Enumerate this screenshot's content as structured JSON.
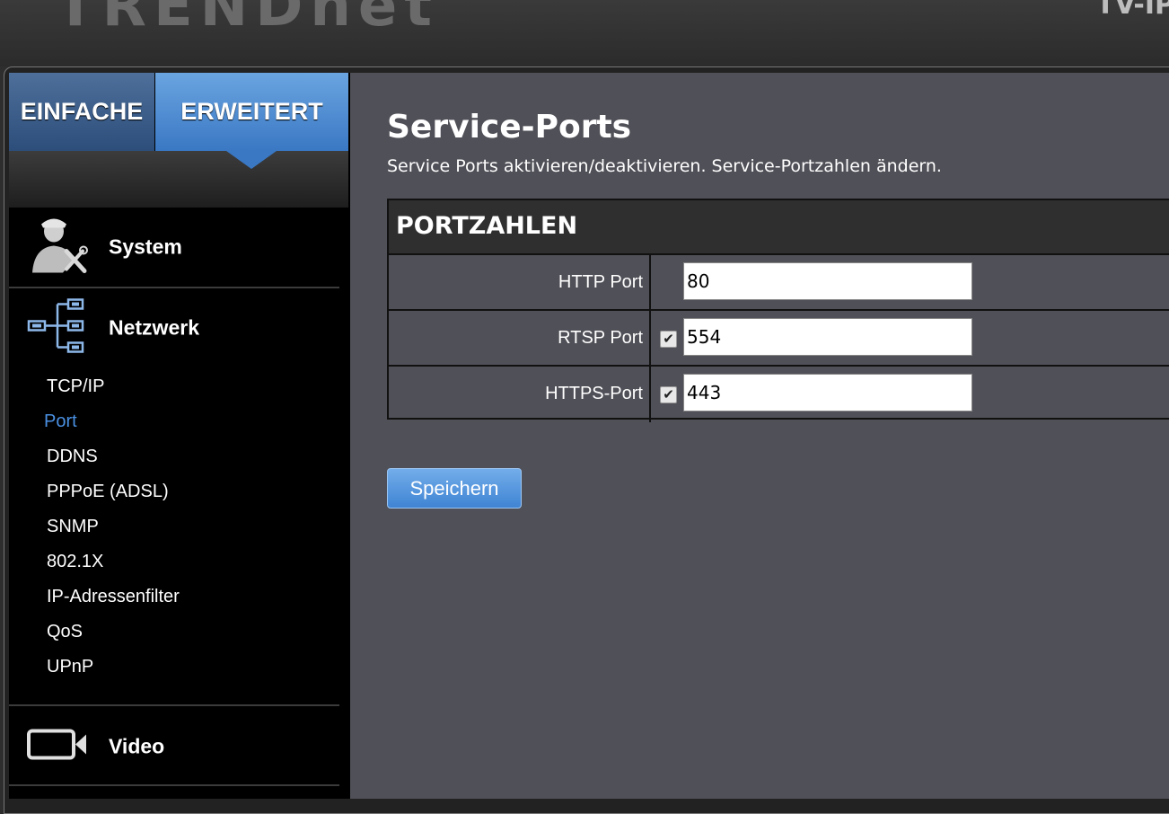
{
  "header": {
    "logo": "TRENDnet",
    "model": "TV-IP"
  },
  "sidebar": {
    "tabs": [
      {
        "label": "EINFACHE"
      },
      {
        "label": "ERWEITERT"
      }
    ],
    "categories": [
      {
        "label": "System",
        "icon": "user-tools-icon"
      },
      {
        "label": "Netzwerk",
        "icon": "network-tree-icon"
      },
      {
        "label": "Video",
        "icon": "video-camera-icon"
      }
    ],
    "network_items": [
      {
        "label": "TCP/IP"
      },
      {
        "label": "Port"
      },
      {
        "label": "DDNS"
      },
      {
        "label": "PPPoE (ADSL)"
      },
      {
        "label": "SNMP"
      },
      {
        "label": "802.1X"
      },
      {
        "label": "IP-Adressenfilter"
      },
      {
        "label": "QoS"
      },
      {
        "label": "UPnP"
      }
    ],
    "active_item": "Port"
  },
  "main": {
    "title": "Service-Ports",
    "description": "Service Ports aktivieren/deaktivieren. Service-Portzahlen ändern.",
    "table_header": "PORTZAHLEN",
    "rows": [
      {
        "label": "HTTP Port",
        "value": "80",
        "has_checkbox": false
      },
      {
        "label": "RTSP Port",
        "value": "554",
        "has_checkbox": true,
        "checked": true
      },
      {
        "label": "HTTPS-Port",
        "value": "443",
        "has_checkbox": true,
        "checked": true
      }
    ],
    "save_label": "Speichern"
  },
  "colors": {
    "accent": "#3a78c4",
    "active_link": "#4a90e2",
    "content_bg": "#505058"
  }
}
